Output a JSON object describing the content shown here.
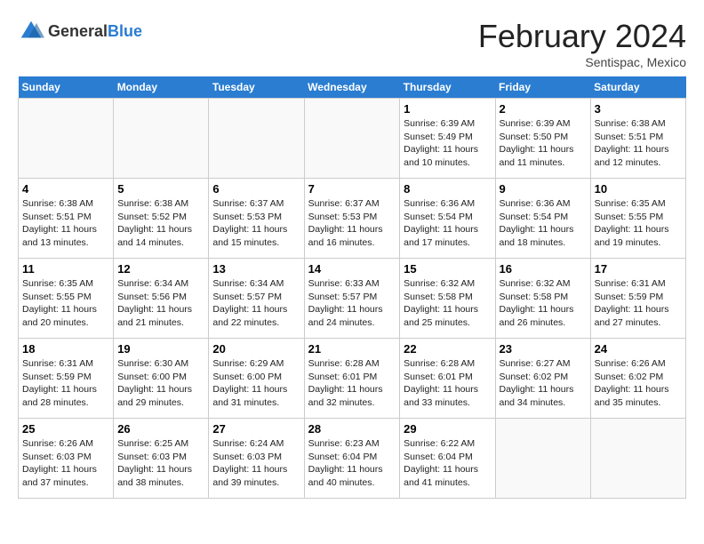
{
  "header": {
    "logo_general": "General",
    "logo_blue": "Blue",
    "month_title": "February 2024",
    "subtitle": "Sentispac, Mexico"
  },
  "days_of_week": [
    "Sunday",
    "Monday",
    "Tuesday",
    "Wednesday",
    "Thursday",
    "Friday",
    "Saturday"
  ],
  "weeks": [
    [
      {
        "day": "",
        "info": ""
      },
      {
        "day": "",
        "info": ""
      },
      {
        "day": "",
        "info": ""
      },
      {
        "day": "",
        "info": ""
      },
      {
        "day": "1",
        "info": "Sunrise: 6:39 AM\nSunset: 5:49 PM\nDaylight: 11 hours and 10 minutes."
      },
      {
        "day": "2",
        "info": "Sunrise: 6:39 AM\nSunset: 5:50 PM\nDaylight: 11 hours and 11 minutes."
      },
      {
        "day": "3",
        "info": "Sunrise: 6:38 AM\nSunset: 5:51 PM\nDaylight: 11 hours and 12 minutes."
      }
    ],
    [
      {
        "day": "4",
        "info": "Sunrise: 6:38 AM\nSunset: 5:51 PM\nDaylight: 11 hours and 13 minutes."
      },
      {
        "day": "5",
        "info": "Sunrise: 6:38 AM\nSunset: 5:52 PM\nDaylight: 11 hours and 14 minutes."
      },
      {
        "day": "6",
        "info": "Sunrise: 6:37 AM\nSunset: 5:53 PM\nDaylight: 11 hours and 15 minutes."
      },
      {
        "day": "7",
        "info": "Sunrise: 6:37 AM\nSunset: 5:53 PM\nDaylight: 11 hours and 16 minutes."
      },
      {
        "day": "8",
        "info": "Sunrise: 6:36 AM\nSunset: 5:54 PM\nDaylight: 11 hours and 17 minutes."
      },
      {
        "day": "9",
        "info": "Sunrise: 6:36 AM\nSunset: 5:54 PM\nDaylight: 11 hours and 18 minutes."
      },
      {
        "day": "10",
        "info": "Sunrise: 6:35 AM\nSunset: 5:55 PM\nDaylight: 11 hours and 19 minutes."
      }
    ],
    [
      {
        "day": "11",
        "info": "Sunrise: 6:35 AM\nSunset: 5:55 PM\nDaylight: 11 hours and 20 minutes."
      },
      {
        "day": "12",
        "info": "Sunrise: 6:34 AM\nSunset: 5:56 PM\nDaylight: 11 hours and 21 minutes."
      },
      {
        "day": "13",
        "info": "Sunrise: 6:34 AM\nSunset: 5:57 PM\nDaylight: 11 hours and 22 minutes."
      },
      {
        "day": "14",
        "info": "Sunrise: 6:33 AM\nSunset: 5:57 PM\nDaylight: 11 hours and 24 minutes."
      },
      {
        "day": "15",
        "info": "Sunrise: 6:32 AM\nSunset: 5:58 PM\nDaylight: 11 hours and 25 minutes."
      },
      {
        "day": "16",
        "info": "Sunrise: 6:32 AM\nSunset: 5:58 PM\nDaylight: 11 hours and 26 minutes."
      },
      {
        "day": "17",
        "info": "Sunrise: 6:31 AM\nSunset: 5:59 PM\nDaylight: 11 hours and 27 minutes."
      }
    ],
    [
      {
        "day": "18",
        "info": "Sunrise: 6:31 AM\nSunset: 5:59 PM\nDaylight: 11 hours and 28 minutes."
      },
      {
        "day": "19",
        "info": "Sunrise: 6:30 AM\nSunset: 6:00 PM\nDaylight: 11 hours and 29 minutes."
      },
      {
        "day": "20",
        "info": "Sunrise: 6:29 AM\nSunset: 6:00 PM\nDaylight: 11 hours and 31 minutes."
      },
      {
        "day": "21",
        "info": "Sunrise: 6:28 AM\nSunset: 6:01 PM\nDaylight: 11 hours and 32 minutes."
      },
      {
        "day": "22",
        "info": "Sunrise: 6:28 AM\nSunset: 6:01 PM\nDaylight: 11 hours and 33 minutes."
      },
      {
        "day": "23",
        "info": "Sunrise: 6:27 AM\nSunset: 6:02 PM\nDaylight: 11 hours and 34 minutes."
      },
      {
        "day": "24",
        "info": "Sunrise: 6:26 AM\nSunset: 6:02 PM\nDaylight: 11 hours and 35 minutes."
      }
    ],
    [
      {
        "day": "25",
        "info": "Sunrise: 6:26 AM\nSunset: 6:03 PM\nDaylight: 11 hours and 37 minutes."
      },
      {
        "day": "26",
        "info": "Sunrise: 6:25 AM\nSunset: 6:03 PM\nDaylight: 11 hours and 38 minutes."
      },
      {
        "day": "27",
        "info": "Sunrise: 6:24 AM\nSunset: 6:03 PM\nDaylight: 11 hours and 39 minutes."
      },
      {
        "day": "28",
        "info": "Sunrise: 6:23 AM\nSunset: 6:04 PM\nDaylight: 11 hours and 40 minutes."
      },
      {
        "day": "29",
        "info": "Sunrise: 6:22 AM\nSunset: 6:04 PM\nDaylight: 11 hours and 41 minutes."
      },
      {
        "day": "",
        "info": ""
      },
      {
        "day": "",
        "info": ""
      }
    ]
  ]
}
